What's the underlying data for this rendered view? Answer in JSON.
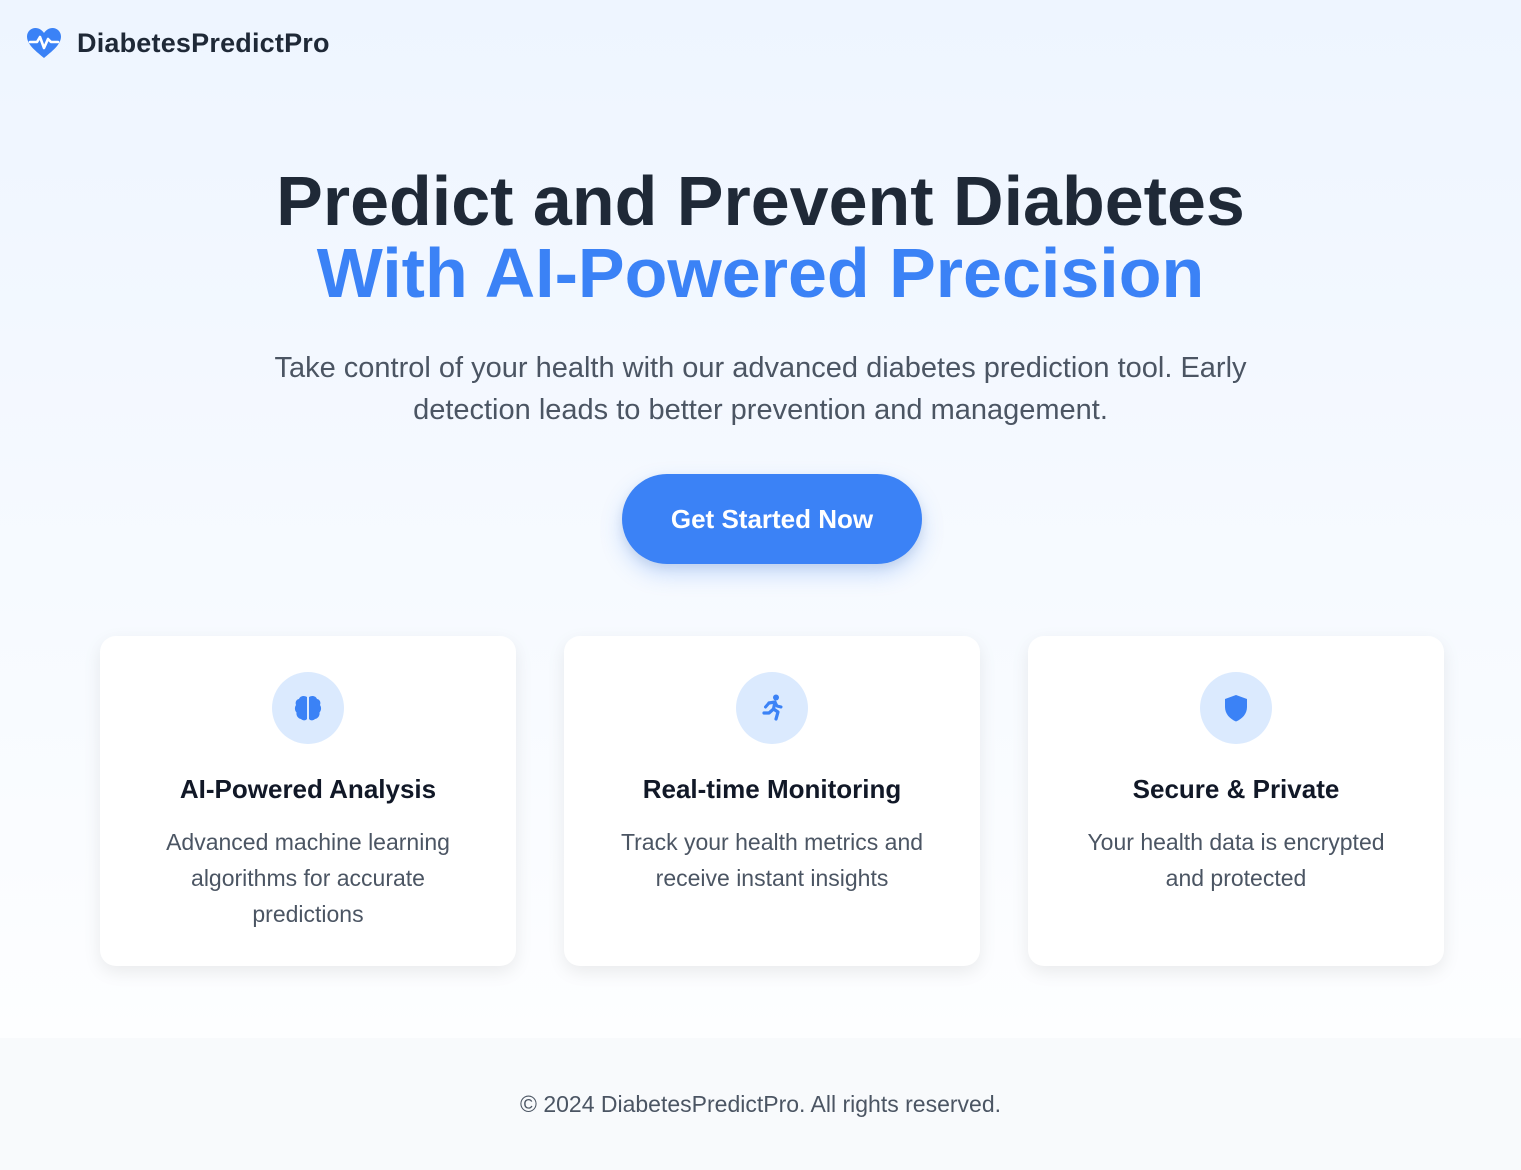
{
  "brand": {
    "name": "DiabetesPredictPro",
    "icon": "heart-pulse-icon"
  },
  "hero": {
    "title_line1": "Predict and Prevent Diabetes",
    "title_line2": "With AI-Powered Precision",
    "subtitle": "Take control of your health with our advanced diabetes prediction tool. Early detection leads to better prevention and management.",
    "cta_label": "Get Started Now"
  },
  "features": [
    {
      "icon": "brain-icon",
      "title": "AI-Powered Analysis",
      "description": "Advanced machine learning algorithms for accurate predictions"
    },
    {
      "icon": "running-person-icon",
      "title": "Real-time Monitoring",
      "description": "Track your health metrics and receive instant insights"
    },
    {
      "icon": "shield-icon",
      "title": "Secure & Private",
      "description": "Your health data is encrypted and protected"
    }
  ],
  "footer": {
    "text": "© 2024 DiabetesPredictPro. All rights reserved."
  },
  "colors": {
    "accent": "#3b82f6",
    "icon_bg": "#dbeafe",
    "heading": "#1f2937",
    "body_text": "#4b5563"
  }
}
